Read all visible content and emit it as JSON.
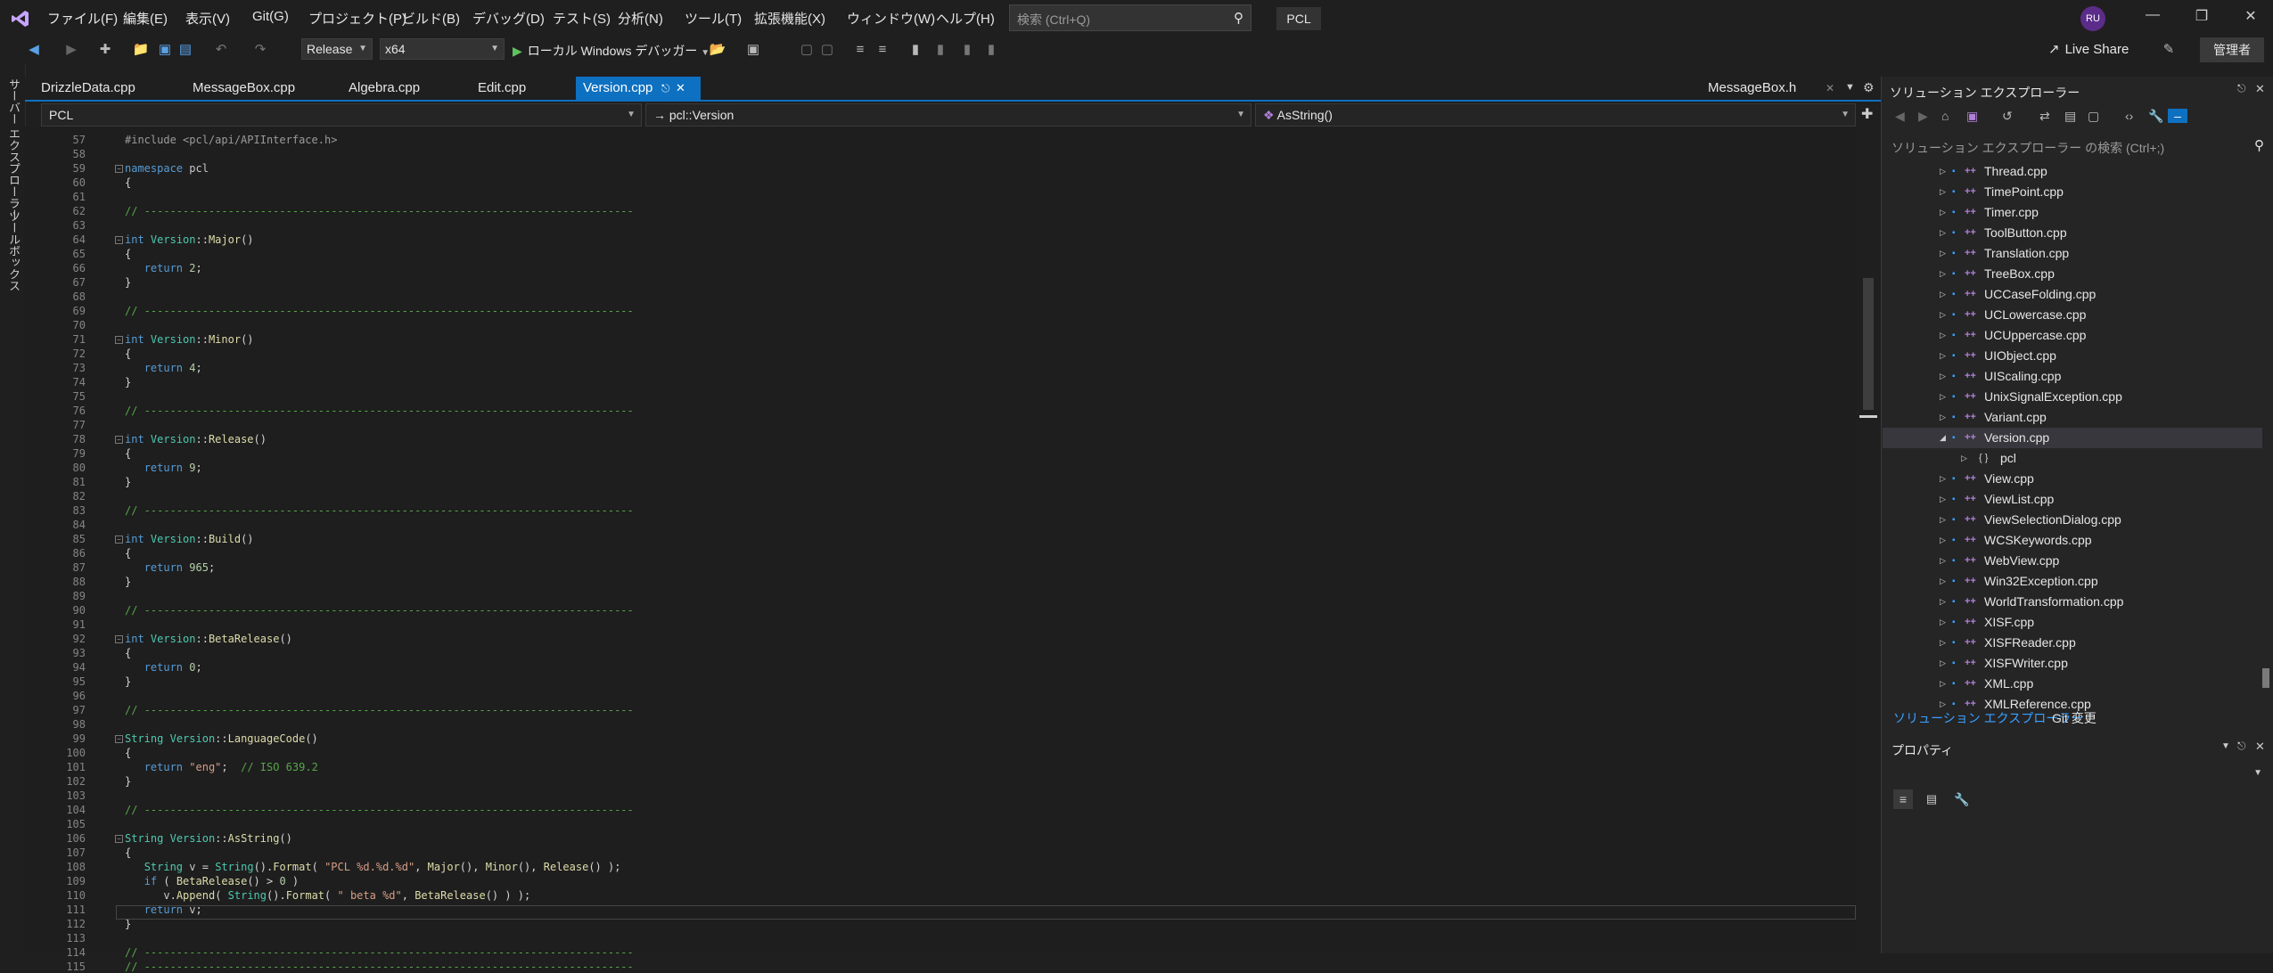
{
  "menu": [
    "ファイル(F)",
    "編集(E)",
    "表示(V)",
    "Git(G)",
    "プロジェクト(P)",
    "ビルド(B)",
    "デバッグ(D)",
    "テスト(S)",
    "分析(N)",
    "ツール(T)",
    "拡張機能(X)",
    "ウィンドウ(W)",
    "ヘルプ(H)"
  ],
  "search": {
    "placeholder": "検索 (Ctrl+Q)"
  },
  "solution_name": "PCL",
  "user_initials": "RU",
  "toolbar": {
    "config": "Release",
    "platform": "x64",
    "run_label": "ローカル Windows デバッガー",
    "live_share": "Live Share",
    "admin": "管理者"
  },
  "side_tabs": [
    "サーバー エクスプローラー",
    "ツールボックス"
  ],
  "tabs": [
    "DrizzleData.cpp",
    "MessageBox.cpp",
    "Algebra.cpp",
    "Edit.cpp",
    "Version.cpp",
    "MessageBox.h"
  ],
  "nav": {
    "project": "PCL",
    "scope": "pcl::Version",
    "member": "AsString()"
  },
  "code_lines": [
    {
      "n": "57",
      "t": "#include <pcl/api/APIInterface.h>"
    },
    {
      "n": "58",
      "t": ""
    },
    {
      "n": "59",
      "t": "namespace pcl"
    },
    {
      "n": "60",
      "t": "{"
    },
    {
      "n": "61",
      "t": ""
    },
    {
      "n": "62",
      "t": "// ----------------------------------------------------------------------------"
    },
    {
      "n": "63",
      "t": ""
    },
    {
      "n": "64",
      "t": "int Version::Major()"
    },
    {
      "n": "65",
      "t": "{"
    },
    {
      "n": "66",
      "t": "   return 2;"
    },
    {
      "n": "67",
      "t": "}"
    },
    {
      "n": "68",
      "t": ""
    },
    {
      "n": "69",
      "t": "// ----------------------------------------------------------------------------"
    },
    {
      "n": "70",
      "t": ""
    },
    {
      "n": "71",
      "t": "int Version::Minor()"
    },
    {
      "n": "72",
      "t": "{"
    },
    {
      "n": "73",
      "t": "   return 4;"
    },
    {
      "n": "74",
      "t": "}"
    },
    {
      "n": "75",
      "t": ""
    },
    {
      "n": "76",
      "t": "// ----------------------------------------------------------------------------"
    },
    {
      "n": "77",
      "t": ""
    },
    {
      "n": "78",
      "t": "int Version::Release()"
    },
    {
      "n": "79",
      "t": "{"
    },
    {
      "n": "80",
      "t": "   return 9;"
    },
    {
      "n": "81",
      "t": "}"
    },
    {
      "n": "82",
      "t": ""
    },
    {
      "n": "83",
      "t": "// ----------------------------------------------------------------------------"
    },
    {
      "n": "84",
      "t": ""
    },
    {
      "n": "85",
      "t": "int Version::Build()"
    },
    {
      "n": "86",
      "t": "{"
    },
    {
      "n": "87",
      "t": "   return 965;"
    },
    {
      "n": "88",
      "t": "}"
    },
    {
      "n": "89",
      "t": ""
    },
    {
      "n": "90",
      "t": "// ----------------------------------------------------------------------------"
    },
    {
      "n": "91",
      "t": ""
    },
    {
      "n": "92",
      "t": "int Version::BetaRelease()"
    },
    {
      "n": "93",
      "t": "{"
    },
    {
      "n": "94",
      "t": "   return 0;"
    },
    {
      "n": "95",
      "t": "}"
    },
    {
      "n": "96",
      "t": ""
    },
    {
      "n": "97",
      "t": "// ----------------------------------------------------------------------------"
    },
    {
      "n": "98",
      "t": ""
    },
    {
      "n": "99",
      "t": "String Version::LanguageCode()"
    },
    {
      "n": "100",
      "t": "{"
    },
    {
      "n": "101",
      "t": "   return \"eng\";  // ISO 639.2"
    },
    {
      "n": "102",
      "t": "}"
    },
    {
      "n": "103",
      "t": ""
    },
    {
      "n": "104",
      "t": "// ----------------------------------------------------------------------------"
    },
    {
      "n": "105",
      "t": ""
    },
    {
      "n": "106",
      "t": "String Version::AsString()"
    },
    {
      "n": "107",
      "t": "{"
    },
    {
      "n": "108",
      "t": "   String v = String().Format( \"PCL %d.%d.%d\", Major(), Minor(), Release() );"
    },
    {
      "n": "109",
      "t": "   if ( BetaRelease() > 0 )"
    },
    {
      "n": "110",
      "t": "      v.Append( String().Format( \" beta %d\", BetaRelease() ) );"
    },
    {
      "n": "111",
      "t": "   return v;"
    },
    {
      "n": "112",
      "t": "}"
    },
    {
      "n": "113",
      "t": ""
    },
    {
      "n": "114",
      "t": "// ----------------------------------------------------------------------------"
    },
    {
      "n": "115",
      "t": "// ----------------------------------------------------------------------------"
    }
  ],
  "solution_explorer": {
    "title": "ソリューション エクスプローラー",
    "search_placeholder": "ソリューション エクスプローラー の検索 (Ctrl+;)",
    "items": [
      "Thread.cpp",
      "TimePoint.cpp",
      "Timer.cpp",
      "ToolButton.cpp",
      "Translation.cpp",
      "TreeBox.cpp",
      "UCCaseFolding.cpp",
      "UCLowercase.cpp",
      "UCUppercase.cpp",
      "UIObject.cpp",
      "UIScaling.cpp",
      "UnixSignalException.cpp",
      "Variant.cpp",
      "Version.cpp",
      "pcl",
      "View.cpp",
      "ViewList.cpp",
      "ViewSelectionDialog.cpp",
      "WCSKeywords.cpp",
      "WebView.cpp",
      "Win32Exception.cpp",
      "WorldTransformation.cpp",
      "XISF.cpp",
      "XISFReader.cpp",
      "XISFWriter.cpp",
      "XML.cpp",
      "XMLReference.cpp"
    ],
    "bottom_tabs": [
      "ソリューション エクスプローラー",
      "Git 変更"
    ]
  },
  "properties": {
    "title": "プロパティ"
  },
  "colors": {
    "accent": "#0e70c0",
    "background": "#1e1e1e",
    "keyword": "#569cd6",
    "type": "#4ec9b0",
    "comment": "#57a64a"
  }
}
